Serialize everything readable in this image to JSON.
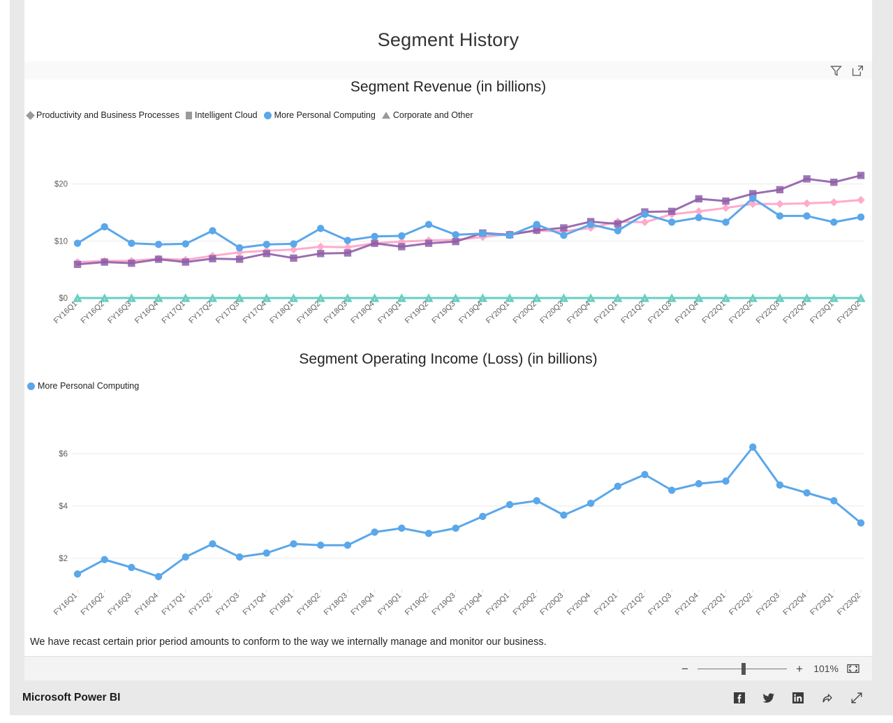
{
  "report": {
    "title": "Segment History",
    "footnote": "We have recast certain prior period amounts to conform to the way we internally manage and monitor our business."
  },
  "visual_header": {
    "filter_icon": "filter-funnel-icon",
    "focus_icon": "focus-mode-icon"
  },
  "zoom_bar": {
    "minus_label": "−",
    "plus_label": "+",
    "percent": "101%",
    "fit_icon": "fit-to-page-icon"
  },
  "footer": {
    "brand": "Microsoft Power BI",
    "icons": [
      "facebook-icon",
      "twitter-icon",
      "linkedin-icon",
      "share-icon",
      "expand-icon"
    ]
  },
  "colors": {
    "productivity": "#FFABCB",
    "intelligent_cloud": "#8E5EA8",
    "more_personal_computing": "#5AA7EA",
    "corporate_other": "#67CFC0",
    "gridline": "#EAEAEA",
    "axis_text": "#605E5C",
    "panel_bg": "#FFFFFF",
    "rail_bg": "#E9E9E9",
    "footer_bg": "#E9E9E9"
  },
  "chart_data": [
    {
      "type": "line",
      "title": "Segment Revenue (in billions)",
      "xlabel": "",
      "ylabel": "",
      "ylim": [
        0,
        24
      ],
      "yticks": [
        0,
        10,
        20
      ],
      "ytick_labels": [
        "$0",
        "$10",
        "$20"
      ],
      "grid": true,
      "legend_position": "top-left",
      "categories": [
        "FY16Q1",
        "FY16Q2",
        "FY16Q3",
        "FY16Q4",
        "FY17Q1",
        "FY17Q2",
        "FY17Q3",
        "FY17Q4",
        "FY18Q1",
        "FY18Q2",
        "FY18Q3",
        "FY18Q4",
        "FY19Q1",
        "FY19Q2",
        "FY19Q3",
        "FY19Q4",
        "FY20Q1",
        "FY20Q2",
        "FY20Q3",
        "FY20Q4",
        "FY21Q1",
        "FY21Q2",
        "FY21Q3",
        "FY21Q4",
        "FY22Q1",
        "FY22Q2",
        "FY22Q3",
        "FY22Q4",
        "FY23Q1",
        "FY23Q2"
      ],
      "series": [
        {
          "name": "Productivity and Business Processes",
          "marker": "diamond",
          "color": "#FFABCB",
          "values": [
            6.3,
            6.5,
            6.5,
            6.9,
            6.7,
            7.4,
            8.0,
            8.3,
            8.5,
            9.0,
            8.9,
            9.6,
            9.9,
            10.1,
            10.2,
            10.7,
            11.2,
            11.8,
            11.7,
            11.8,
            12.3,
            13.4,
            13.3,
            14.7,
            15.9,
            15.8,
            16.5,
            16.5,
            16.5,
            16.6,
            17.0
          ],
          "plot_values": [
            6.3,
            6.5,
            6.5,
            6.9,
            6.7,
            7.4,
            8.0,
            8.3,
            8.5,
            9.0,
            8.9,
            9.6,
            9.9,
            10.1,
            10.2,
            10.7,
            11.2,
            11.8,
            11.7,
            12.3,
            13.4,
            13.3,
            14.7,
            15.2,
            15.8,
            16.5,
            16.5,
            16.6,
            16.8,
            17.2
          ]
        },
        {
          "name": "Intelligent Cloud",
          "marker": "square",
          "color": "#8E5EA8",
          "values": [
            5.9,
            6.3,
            6.1,
            6.8,
            6.3,
            6.9,
            6.8,
            7.8,
            7.0,
            7.8,
            7.9,
            9.6,
            9.0,
            9.6,
            9.9,
            11.4,
            11.1,
            11.9,
            12.3,
            13.4,
            13.0,
            15.1,
            15.2,
            17.4,
            17.0,
            18.3,
            19.0,
            20.9,
            20.3,
            21.5
          ],
          "plot_values": [
            5.9,
            6.3,
            6.1,
            6.8,
            6.3,
            6.9,
            6.8,
            7.8,
            7.0,
            7.8,
            7.9,
            9.6,
            9.0,
            9.6,
            9.9,
            11.4,
            11.1,
            11.9,
            12.3,
            13.4,
            13.0,
            15.1,
            15.2,
            17.4,
            17.0,
            18.3,
            19.0,
            20.9,
            20.3,
            21.5
          ]
        },
        {
          "name": "More Personal Computing",
          "marker": "circle",
          "color": "#5AA7EA",
          "values": [
            9.6,
            12.5,
            9.6,
            9.4,
            9.5,
            11.8,
            8.8,
            9.4,
            9.5,
            12.2,
            10.1,
            10.8,
            10.9,
            12.9,
            11.1,
            11.3,
            11.0,
            12.9,
            11.0,
            12.9,
            11.8,
            14.7,
            13.3,
            14.1,
            13.3,
            17.5,
            14.4,
            14.4,
            13.3,
            14.2
          ],
          "plot_values": [
            9.6,
            12.5,
            9.6,
            9.4,
            9.5,
            11.8,
            8.8,
            9.4,
            9.5,
            12.2,
            10.1,
            10.8,
            10.9,
            12.9,
            11.1,
            11.3,
            11.0,
            12.9,
            11.0,
            12.9,
            11.8,
            14.7,
            13.3,
            14.1,
            13.3,
            17.5,
            14.4,
            14.4,
            13.3,
            14.2
          ]
        },
        {
          "name": "Corporate and Other",
          "marker": "triangle",
          "color": "#67CFC0",
          "values": [
            0,
            0,
            0,
            0,
            0,
            0,
            0,
            0,
            0,
            0,
            0,
            0,
            0,
            0,
            0,
            0,
            0,
            0,
            0,
            0,
            0,
            0,
            0,
            0,
            0,
            0,
            0,
            0,
            0,
            0
          ],
          "plot_values": [
            0,
            0,
            0,
            0,
            0,
            0,
            0,
            0,
            0,
            0,
            0,
            0,
            0,
            0,
            0,
            0,
            0,
            0,
            0,
            0,
            0,
            0,
            0,
            0,
            0,
            0,
            0,
            0,
            0,
            0
          ]
        }
      ]
    },
    {
      "type": "line",
      "title": "Segment Operating Income (Loss) (in billions)",
      "xlabel": "",
      "ylabel": "",
      "ylim": [
        0.8,
        6.8
      ],
      "yticks": [
        2,
        4,
        6
      ],
      "ytick_labels": [
        "$2",
        "$4",
        "$6"
      ],
      "grid": true,
      "legend_position": "top-left",
      "categories": [
        "FY16Q1",
        "FY16Q2",
        "FY16Q3",
        "FY16Q4",
        "FY17Q1",
        "FY17Q2",
        "FY17Q3",
        "FY17Q4",
        "FY18Q1",
        "FY18Q2",
        "FY18Q3",
        "FY18Q4",
        "FY19Q1",
        "FY19Q2",
        "FY19Q3",
        "FY19Q4",
        "FY20Q1",
        "FY20Q2",
        "FY20Q3",
        "FY20Q4",
        "FY21Q1",
        "FY21Q2",
        "FY21Q3",
        "FY21Q4",
        "FY22Q1",
        "FY22Q2",
        "FY22Q3",
        "FY22Q4",
        "FY23Q1",
        "FY23Q2"
      ],
      "series": [
        {
          "name": "More Personal Computing",
          "marker": "circle",
          "color": "#5AA7EA",
          "values": [
            1.4,
            1.95,
            1.65,
            1.3,
            2.05,
            2.55,
            2.05,
            2.2,
            2.55,
            2.5,
            2.5,
            3.0,
            3.15,
            2.95,
            3.15,
            3.6,
            4.05,
            4.2,
            3.65,
            4.1,
            4.75,
            5.2,
            4.6,
            4.85,
            4.95,
            6.25,
            4.8,
            4.5,
            4.2,
            3.35
          ],
          "plot_values": [
            1.4,
            1.95,
            1.65,
            1.3,
            2.05,
            2.55,
            2.05,
            2.2,
            2.55,
            2.5,
            2.5,
            3.0,
            3.15,
            2.95,
            3.15,
            3.6,
            4.05,
            4.2,
            3.65,
            4.1,
            4.75,
            5.2,
            4.6,
            4.85,
            4.95,
            6.25,
            4.8,
            4.5,
            4.2,
            3.35
          ]
        }
      ]
    }
  ]
}
